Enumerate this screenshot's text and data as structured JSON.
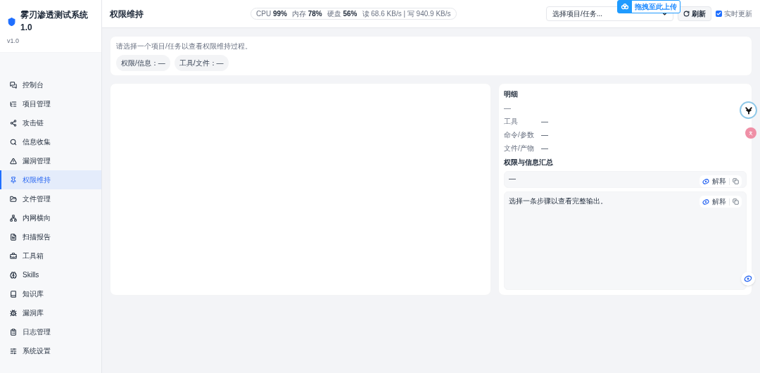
{
  "brand": {
    "title": "雾刃渗透测试系统 1.0",
    "version": "v1.0"
  },
  "nav": [
    {
      "label": "控制台",
      "selected": false
    },
    {
      "label": "项目管理",
      "selected": false
    },
    {
      "label": "攻击链",
      "selected": false
    },
    {
      "label": "信息收集",
      "selected": false
    },
    {
      "label": "漏洞管理",
      "selected": false
    },
    {
      "label": "权限维持",
      "selected": true
    },
    {
      "label": "文件管理",
      "selected": false
    },
    {
      "label": "内网横向",
      "selected": false
    },
    {
      "label": "扫描报告",
      "selected": false
    },
    {
      "label": "工具箱",
      "selected": false
    },
    {
      "label": "Skills",
      "selected": false
    },
    {
      "label": "知识库",
      "selected": false
    },
    {
      "label": "漏洞库",
      "selected": false
    },
    {
      "label": "日志管理",
      "selected": false
    },
    {
      "label": "系统设置",
      "selected": false
    }
  ],
  "header": {
    "title": "权限维持",
    "stats": [
      {
        "label": "CPU",
        "value": "99%"
      },
      {
        "label": "内存",
        "value": "78%"
      },
      {
        "label": "硬盘",
        "value": "56%"
      }
    ],
    "io": "读 68.6 KB/s | 写 940.9 KB/s",
    "select": {
      "value": "选择项目/任务..."
    },
    "refresh": "刷新",
    "realtime": {
      "label": "实时更新",
      "checked": true
    },
    "upload_badge": "拖拽至此上传"
  },
  "info_card": {
    "text": "请选择一个项目/任务以查看权限维持过程。",
    "chips": [
      "权限/信息：—",
      "工具/文件：—"
    ]
  },
  "detail": {
    "title": "明细",
    "value": "—",
    "fields": [
      {
        "label": "工具",
        "value": "—"
      },
      {
        "label": "命令/参数",
        "value": "—"
      },
      {
        "label": "文件/产物",
        "value": "—"
      }
    ],
    "summary_title": "权限与信息汇总",
    "summary": {
      "text": "—",
      "explain": "解释"
    },
    "output": {
      "text": "选择一条步骤以查看完整输出。",
      "explain": "解释"
    }
  }
}
